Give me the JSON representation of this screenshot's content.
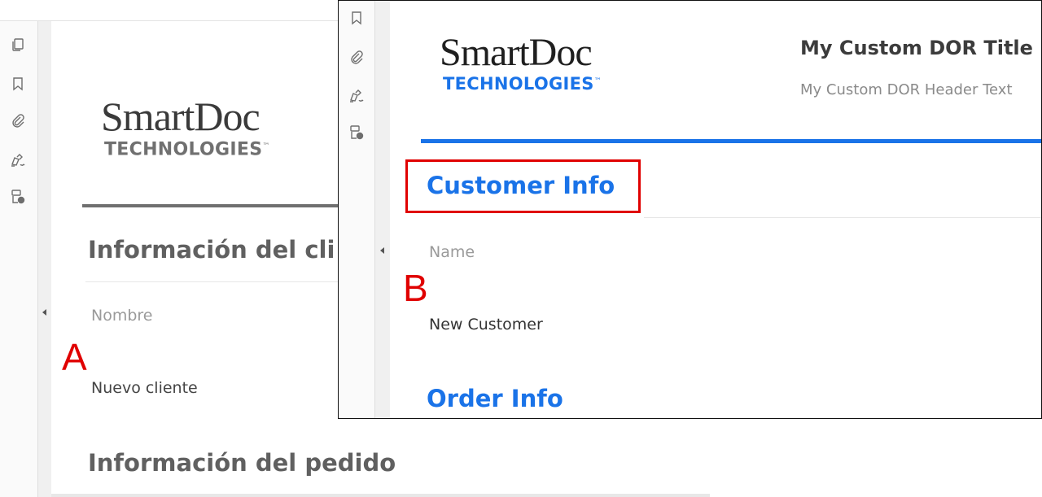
{
  "panel_a": {
    "marker": "A",
    "logo": {
      "name": "SmartDoc",
      "sub": "TECHNOLOGIES",
      "tm": "™"
    },
    "section_customer": "Información del cli",
    "name_label": "Nombre",
    "name_value": "Nuevo cliente",
    "section_order": "Información del pedido",
    "toolbar_icons": [
      "pages-icon",
      "bookmark-icon",
      "attachment-icon",
      "signature-icon",
      "document-lock-icon"
    ],
    "accent_color": "#606060"
  },
  "panel_b": {
    "marker": "B",
    "logo": {
      "name": "SmartDoc",
      "sub": "TECHNOLOGIES",
      "tm": "™"
    },
    "title": "My Custom DOR Title",
    "header_text": "My Custom DOR Header Text",
    "section_customer": "Customer Info",
    "name_label": "Name",
    "name_value": "New Customer",
    "section_order": "Order Info",
    "toolbar_icons": [
      "bookmark-icon",
      "attachment-icon",
      "signature-icon",
      "document-lock-icon"
    ],
    "accent_color": "#1a73e8",
    "highlight_color": "#e00000"
  }
}
